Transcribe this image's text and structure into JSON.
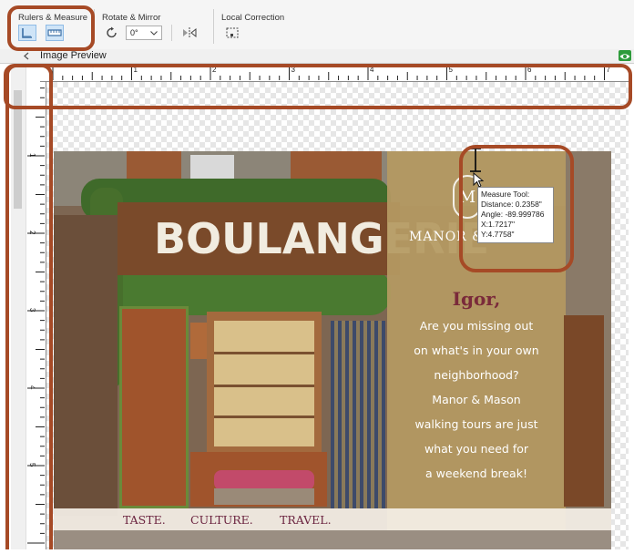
{
  "toolbar": {
    "rulers_group_label": "Rulers & Measure",
    "rotate_group_label": "Rotate & Mirror",
    "rotate_angle_value": "0°",
    "local_correction_label": "Local Correction"
  },
  "preview": {
    "title": "Image Preview",
    "ruler_h_labels": [
      "1",
      "2",
      "3",
      "4",
      "5",
      "6",
      "7"
    ],
    "ruler_v_labels": [
      "1",
      "2",
      "3",
      "4",
      "5"
    ]
  },
  "photo": {
    "shop_sign": "BOULANGERIE",
    "brand_partial": "MANOR &",
    "greeting": "Igor,",
    "promo_lines": [
      "Are you missing out",
      "on what's in your own",
      "neighborhood?",
      "Manor & Mason",
      "walking tours are just",
      "what you need for",
      "a weekend break!"
    ],
    "footer_words": [
      "TASTE.",
      "CULTURE.",
      "TRAVEL."
    ]
  },
  "measure_tooltip": {
    "title": "Measure Tool:",
    "distance": "Distance: 0.2358\"",
    "angle": "Angle: -89.999786",
    "x": "X:1.7217\"",
    "y": "Y:4.7758\""
  },
  "colors": {
    "callout_outline": "#a64a26",
    "selected_button": "#cfe4f7",
    "promo_panel": "#b59a62",
    "greeting_text": "#7a2a3a",
    "footer_text": "#6b2440"
  }
}
